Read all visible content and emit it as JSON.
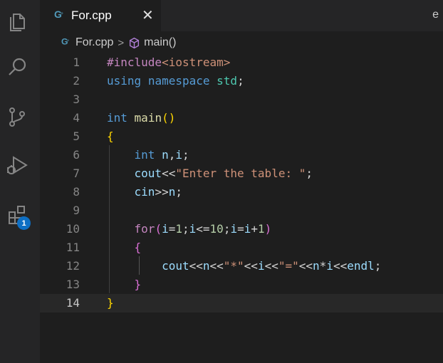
{
  "activity_bar": {
    "items": [
      {
        "icon": "files-icon"
      },
      {
        "icon": "search-icon"
      },
      {
        "icon": "source-control-icon"
      },
      {
        "icon": "run-debug-icon"
      },
      {
        "icon": "extensions-icon",
        "badge": "1"
      }
    ],
    "badge_color": "#0e6fc4"
  },
  "tab": {
    "title": "For.cpp",
    "close_glyph": "✕",
    "icon": "cpp-file-icon",
    "icon_color": "#519aba"
  },
  "right_edge_text": "e",
  "breadcrumb": {
    "file": "For.cpp",
    "separator": ">",
    "symbol": "main()",
    "symbol_icon": "cube-method-icon",
    "symbol_icon_color": "#b180d7"
  },
  "editor": {
    "current_line": 14,
    "lines": [
      {
        "n": "1",
        "tokens": [
          [
            "#include",
            "dir"
          ],
          [
            "<iostream>",
            "inc"
          ]
        ]
      },
      {
        "n": "2",
        "tokens": [
          [
            "using",
            "blue"
          ],
          [
            " ",
            "op"
          ],
          [
            "namespace",
            "blue"
          ],
          [
            " ",
            "op"
          ],
          [
            "std",
            "ns"
          ],
          [
            ";",
            "op"
          ]
        ]
      },
      {
        "n": "3",
        "tokens": []
      },
      {
        "n": "4",
        "tokens": [
          [
            "int",
            "blue"
          ],
          [
            " ",
            "op"
          ],
          [
            "main",
            "fn"
          ],
          [
            "()",
            "br1"
          ]
        ]
      },
      {
        "n": "5",
        "tokens": [
          [
            "{",
            "br1"
          ]
        ]
      },
      {
        "n": "6",
        "tokens": [
          [
            "    ",
            "op"
          ],
          [
            "int",
            "blue"
          ],
          [
            " ",
            "op"
          ],
          [
            "n",
            "var"
          ],
          [
            ",",
            "op"
          ],
          [
            "i",
            "var"
          ],
          [
            ";",
            "op"
          ]
        ]
      },
      {
        "n": "7",
        "tokens": [
          [
            "    ",
            "op"
          ],
          [
            "cout",
            "var"
          ],
          [
            "<<",
            "op"
          ],
          [
            "\"Enter the table: \"",
            "str"
          ],
          [
            ";",
            "op"
          ]
        ]
      },
      {
        "n": "8",
        "tokens": [
          [
            "    ",
            "op"
          ],
          [
            "cin",
            "var"
          ],
          [
            ">>",
            "op"
          ],
          [
            "n",
            "var"
          ],
          [
            ";",
            "op"
          ]
        ]
      },
      {
        "n": "9",
        "tokens": []
      },
      {
        "n": "10",
        "tokens": [
          [
            "    ",
            "op"
          ],
          [
            "for",
            "ctrl"
          ],
          [
            "(",
            "br2"
          ],
          [
            "i",
            "var"
          ],
          [
            "=",
            "op"
          ],
          [
            "1",
            "num"
          ],
          [
            ";",
            "op"
          ],
          [
            "i",
            "var"
          ],
          [
            "<=",
            "op"
          ],
          [
            "10",
            "num"
          ],
          [
            ";",
            "op"
          ],
          [
            "i",
            "var"
          ],
          [
            "=",
            "op"
          ],
          [
            "i",
            "var"
          ],
          [
            "+",
            "op"
          ],
          [
            "1",
            "num"
          ],
          [
            ")",
            "br2"
          ]
        ]
      },
      {
        "n": "11",
        "tokens": [
          [
            "    ",
            "op"
          ],
          [
            "{",
            "br2"
          ]
        ]
      },
      {
        "n": "12",
        "tokens": [
          [
            "        ",
            "op"
          ],
          [
            "cout",
            "var"
          ],
          [
            "<<",
            "op"
          ],
          [
            "n",
            "var"
          ],
          [
            "<<",
            "op"
          ],
          [
            "\"*\"",
            "str"
          ],
          [
            "<<",
            "op"
          ],
          [
            "i",
            "var"
          ],
          [
            "<<",
            "op"
          ],
          [
            "\"=\"",
            "str"
          ],
          [
            "<<",
            "op"
          ],
          [
            "n",
            "var"
          ],
          [
            "*",
            "op"
          ],
          [
            "i",
            "var"
          ],
          [
            "<<",
            "op"
          ],
          [
            "endl",
            "var"
          ],
          [
            ";",
            "op"
          ]
        ]
      },
      {
        "n": "13",
        "tokens": [
          [
            "    ",
            "op"
          ],
          [
            "}",
            "br2"
          ]
        ]
      },
      {
        "n": "14",
        "tokens": [
          [
            "}",
            "br1"
          ]
        ]
      }
    ]
  }
}
